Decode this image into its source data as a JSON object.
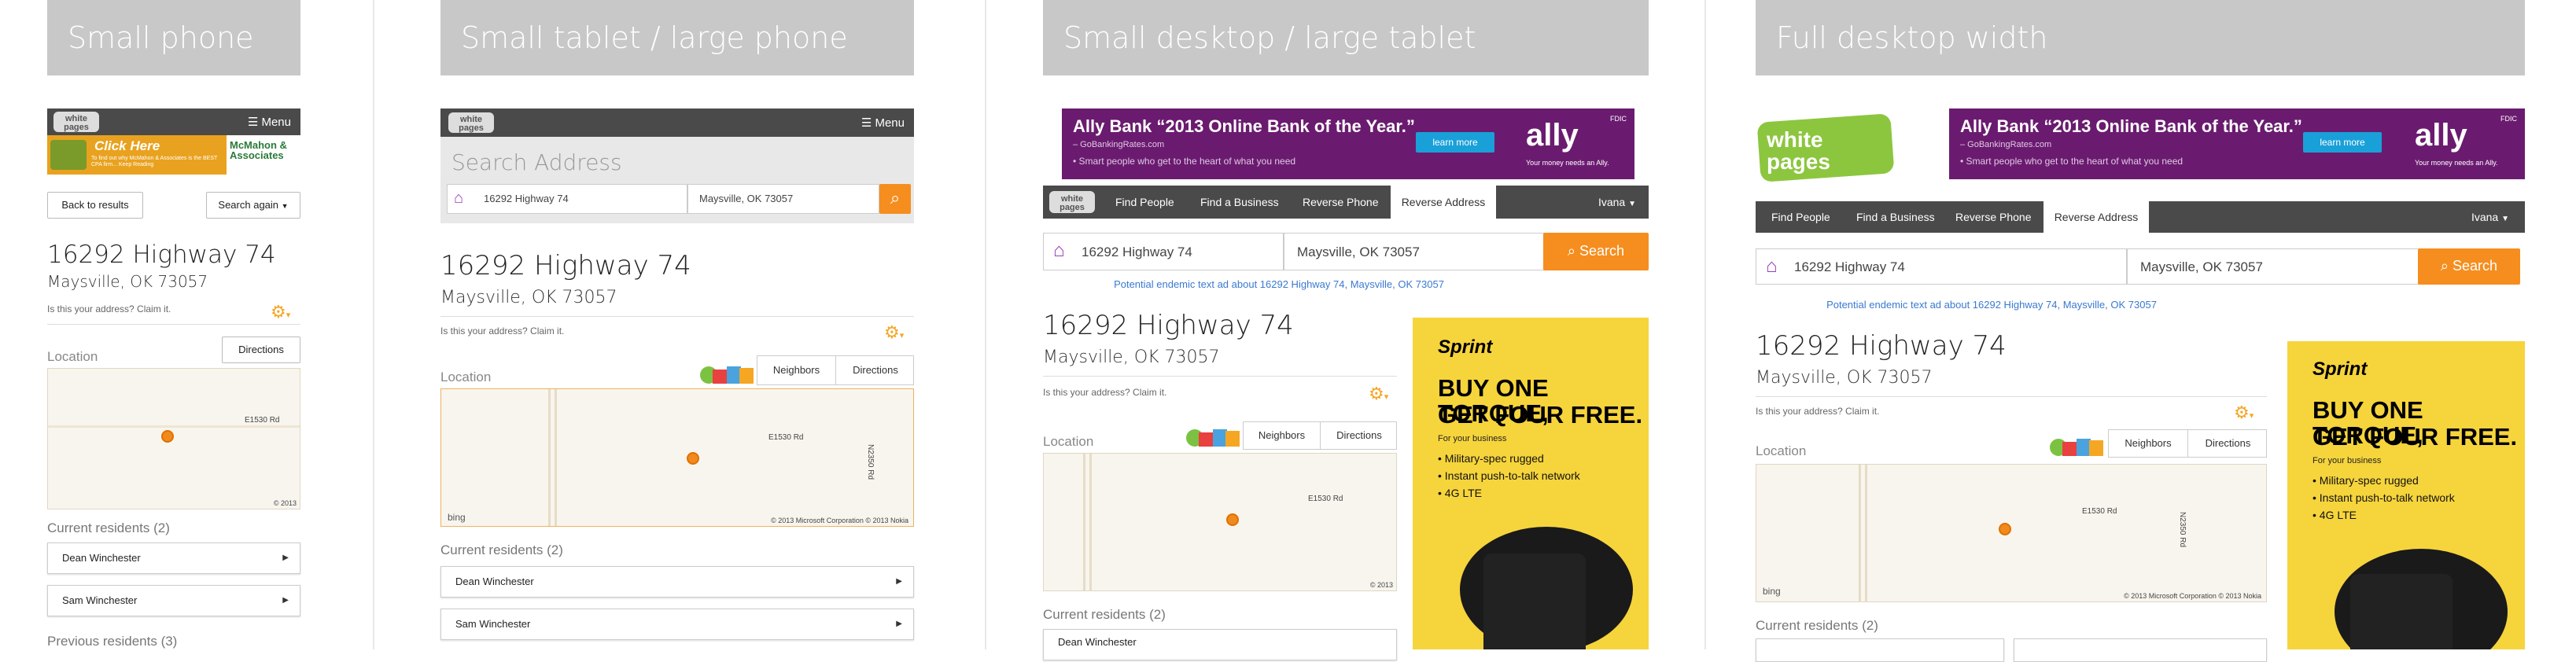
{
  "frames": [
    {
      "header": "Small phone"
    },
    {
      "header": "Small tablet / large phone"
    },
    {
      "header": "Small desktop / large tablet"
    },
    {
      "header": "Full desktop width"
    }
  ],
  "logo_text": "white pages",
  "menu_label": "Menu",
  "phone_ad": {
    "line1": "Click Here",
    "line2": "To find out why McMahon & Associates is the BEST CPA firm... Keep Reading",
    "brand": "McMahon & Associates"
  },
  "back_label": "Back to results",
  "search_again_label": "Search again",
  "address_line1": "16292 Highway 74",
  "address_line2": "Maysville, OK 73057",
  "claim_text": "Is this your address? Claim it.",
  "directions_label": "Directions",
  "neighbors_label": "Neighbors",
  "location_label": "Location",
  "map": {
    "road_label": "E1530 Rd",
    "road_label_v": "N2350 Rd",
    "copyright_short": "© 2013",
    "copyright": "© 2013 Microsoft Corporation © 2013 Nokia",
    "bing": "bing"
  },
  "current_residents_label": "Current residents (2)",
  "previous_residents_label": "Previous residents (3)",
  "residents": [
    "Dean Winchester",
    "Sam Winchester"
  ],
  "search": {
    "placeholder_big": "Search Address",
    "street": "16292 Highway 74",
    "city": "Maysville, OK 73057",
    "button": "Search"
  },
  "ally_ad": {
    "title": "Ally Bank “2013 Online Bank of the Year.”",
    "source": "– GoBankingRates.com",
    "sub": "• Smart people who get to the heart of what you need",
    "learn": "learn more",
    "brand": "ally",
    "tag": "Your money needs an Ally.",
    "fdic": "FDIC"
  },
  "nav": {
    "items": [
      "Find People",
      "Find a Business",
      "Reverse Phone",
      "Reverse Address"
    ],
    "user": "Ivana"
  },
  "endemic_text": "Potential endemic text ad about 16292 Highway 74, Maysville, OK 73057",
  "sprint_ad": {
    "brand": "Sprint",
    "headline1": "BUY ONE TORQUE,",
    "headline2": "GET FOUR FREE.",
    "forbiz": "For your business",
    "bullets": [
      "• Military-spec rugged",
      "• Instant push-to-talk network",
      "• 4G LTE"
    ]
  },
  "colors": {
    "accent": "#f58e1f",
    "nav": "#4a4a4a",
    "header": "#c8c8c8",
    "link": "#3a7ad0",
    "ally": "#6a1b6f",
    "sprint": "#f6d43c"
  }
}
